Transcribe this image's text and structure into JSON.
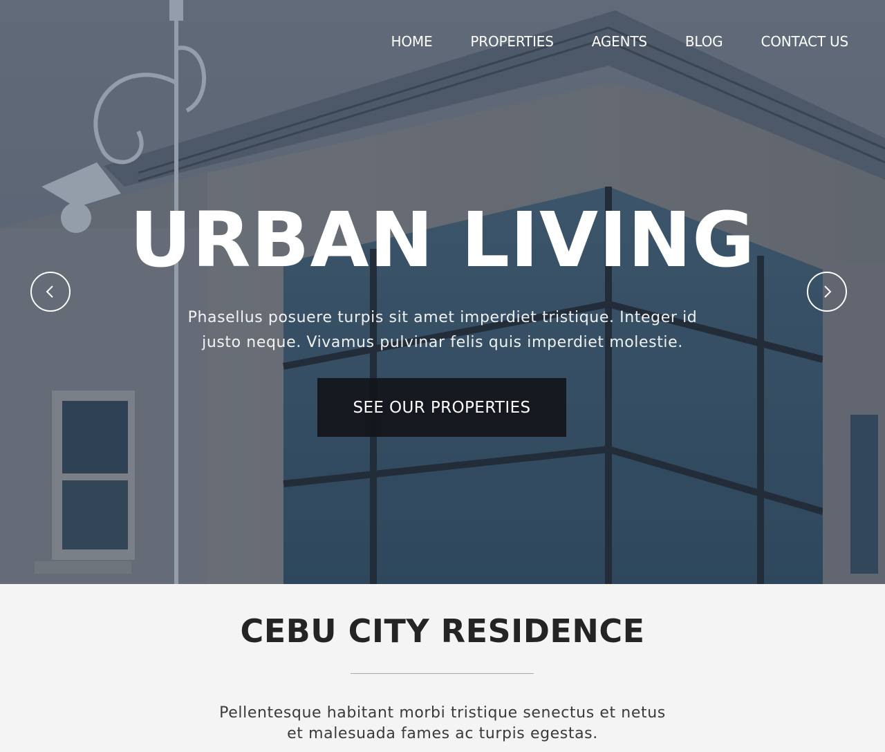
{
  "nav": {
    "items": [
      {
        "label": "HOME"
      },
      {
        "label": "PROPERTIES"
      },
      {
        "label": "AGENTS"
      },
      {
        "label": "BLOG"
      },
      {
        "label": "CONTACT US"
      }
    ]
  },
  "hero": {
    "title": "URBAN LIVING",
    "subtitle_line1": "Phasellus posuere turpis sit amet imperdiet tristique. Integer id",
    "subtitle_line2": "justo neque. Vivamus pulvinar felis quis imperdiet molestie.",
    "cta_label": "SEE OUR PROPERTIES",
    "prev_icon": "chevron-left-icon",
    "next_icon": "chevron-right-icon"
  },
  "intro": {
    "title": "CEBU CITY RESIDENCE",
    "text_line1": "Pellentesque habitant morbi tristique senectus et netus",
    "text_line2": "et malesuada fames ac turpis egestas."
  },
  "colors": {
    "overlay": "#5d6877",
    "cta_background": "#121418",
    "intro_background": "#f4f4f4",
    "intro_title": "#242424"
  }
}
